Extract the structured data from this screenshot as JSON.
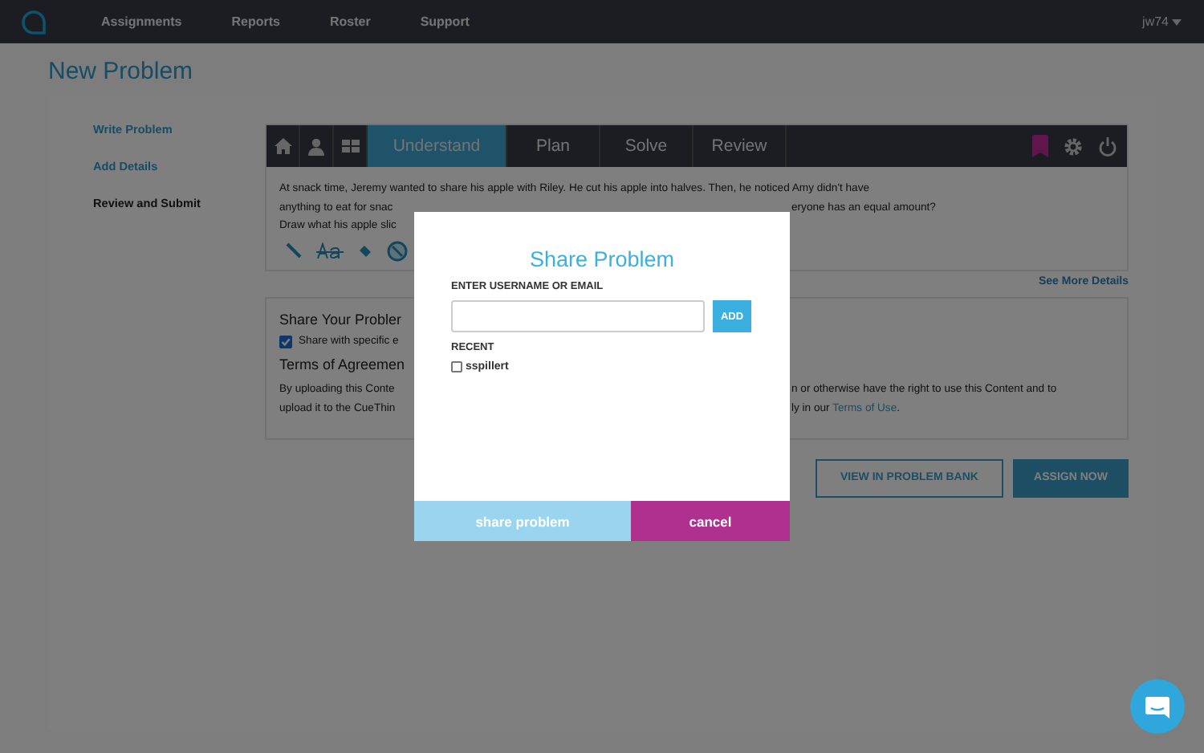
{
  "nav": {
    "items": [
      "Assignments",
      "Reports",
      "Roster",
      "Support"
    ],
    "user": "jw74"
  },
  "page_title": "New Problem",
  "sidebar": {
    "items": [
      {
        "label": "Write Problem",
        "selected": false
      },
      {
        "label": "Add Details",
        "selected": false
      },
      {
        "label": "Review and Submit",
        "selected": true
      }
    ]
  },
  "tabs": [
    {
      "label": "Understand",
      "selected": true
    },
    {
      "label": "Plan",
      "selected": false
    },
    {
      "label": "Solve",
      "selected": false
    },
    {
      "label": "Review",
      "selected": false
    }
  ],
  "problem_text": {
    "line_1": "At snack time, Jeremy wanted to share his apple with Riley. He cut his apple into halves. Then, he noticed Amy didn't have",
    "line_2_left": "anything to eat for snac",
    "line_2_right": "eryone has an equal amount?",
    "line_3_left": "Draw what his apple slic"
  },
  "see_more": "See More Details",
  "share_section": {
    "heading": "Share Your Probler",
    "checkbox": {
      "label": "Share with specific e",
      "checked": true
    },
    "terms_heading": "Terms of Agreemen",
    "terms_1_left": "By uploading this Conte",
    "terms_1_right": "n or otherwise have the right to use this Content and to",
    "terms_2_left": "upload it to the CueThin",
    "terms_2_right": "ly in our ",
    "terms_link": "Terms of Use",
    "terms_end": "."
  },
  "buttons": [
    {
      "label": "VIEW IN PROBLEM BANK",
      "kind": "outline"
    },
    {
      "label": "ASSIGN NOW",
      "kind": "filled"
    }
  ],
  "modal": {
    "title": "Share Problem",
    "field_label": "ENTER USERNAME OR EMAIL",
    "add": "ADD",
    "recent_label": "RECENT",
    "recent": [
      {
        "name": "sspillert",
        "checked": false
      }
    ],
    "share": "share problem",
    "cancel": "cancel"
  }
}
